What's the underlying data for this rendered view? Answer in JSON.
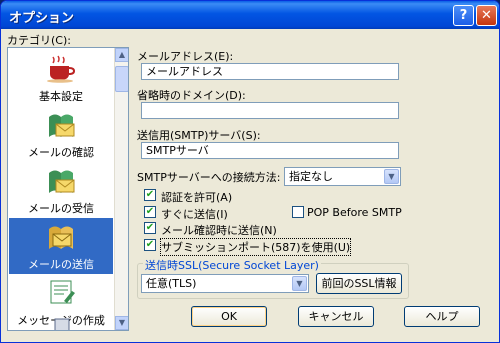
{
  "window": {
    "title": "オプション",
    "help_glyph": "?",
    "close_glyph": "✕"
  },
  "categories": {
    "label": "カテゴリ(C):",
    "items": [
      {
        "label": "基本設定",
        "icon": "coffee-cup-icon",
        "selected": false
      },
      {
        "label": "メールの確認",
        "icon": "mail-check-icon",
        "selected": false
      },
      {
        "label": "メールの受信",
        "icon": "mail-receive-icon",
        "selected": false
      },
      {
        "label": "メールの送信",
        "icon": "mail-send-icon",
        "selected": true
      },
      {
        "label": "メッセージの作成",
        "icon": "compose-message-icon",
        "selected": false
      }
    ]
  },
  "form": {
    "email_label": "メールアドレス(E):",
    "email_value": "メールアドレス",
    "domain_label": "省略時のドメイン(D):",
    "domain_value": "",
    "smtp_label": "送信用(SMTP)サーバ(S):",
    "smtp_value": "SMTPサーバ",
    "auth_method_label": "SMTPサーバーへの接続方法:",
    "auth_method_value": "指定なし",
    "checkboxes": {
      "auth": {
        "label": "認証を許可(A)",
        "checked": true
      },
      "send_immediately": {
        "label": "すぐに送信(I)",
        "checked": true
      },
      "pop_before_smtp": {
        "label": "POP Before SMTP",
        "checked": false
      },
      "send_on_check": {
        "label": "メール確認時に送信(N)",
        "checked": true
      },
      "submission_port": {
        "label": "サブミッションポート(587)を使用(U)",
        "checked": true
      }
    },
    "ssl_group_title": "送信時SSL(Secure Socket Layer)",
    "ssl_value": "任意(TLS)",
    "ssl_info_button": "前回のSSL情報"
  },
  "buttons": {
    "ok": "OK",
    "cancel": "キャンセル",
    "help": "ヘルプ"
  },
  "check_glyph": "✔",
  "colors": {
    "selection": "#316ac5",
    "titlebar": "#0255e3",
    "group_title": "#0046d5"
  }
}
